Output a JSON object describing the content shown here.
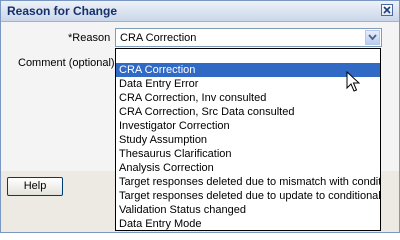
{
  "dialog": {
    "title": "Reason for Change",
    "reason_label": "*Reason",
    "comment_label": "Comment (optional)",
    "help_label": "Help",
    "close_icon": "close-icon"
  },
  "reason_select": {
    "selected_value": "CRA Correction",
    "arrow_icon": "chevron-down-icon"
  },
  "dropdown": {
    "options": [
      "CRA Correction",
      "Data Entry Error",
      "CRA Correction, Inv consulted",
      "CRA Correction, Src Data consulted",
      "Investigator Correction",
      "Study Assumption",
      "Thesaurus Clarification",
      "Analysis Correction",
      "Target responses deleted due to mismatch with condit",
      "Target responses deleted due to update to conditional",
      "Validation Status changed",
      "Data Entry Mode"
    ],
    "highlighted_index": 0
  },
  "colors": {
    "highlight": "#316ac5",
    "title_text": "#15306a"
  }
}
